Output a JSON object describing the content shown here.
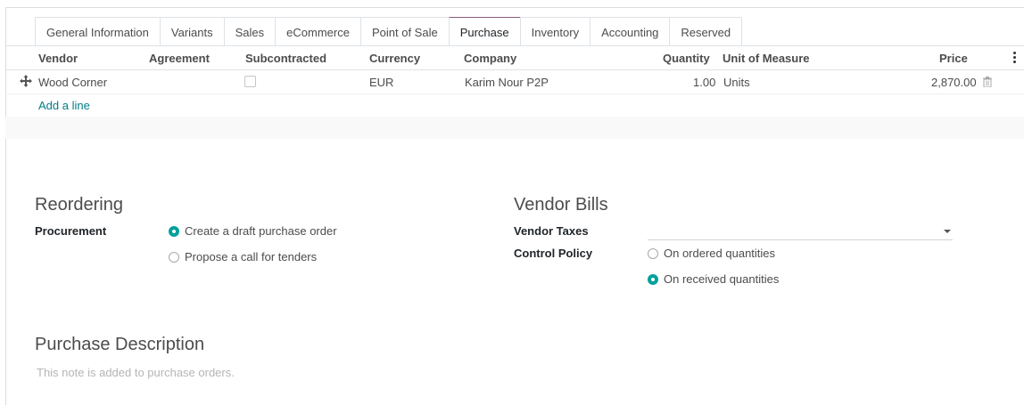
{
  "tabs": [
    {
      "label": "General Information",
      "active": false
    },
    {
      "label": "Variants",
      "active": false
    },
    {
      "label": "Sales",
      "active": false
    },
    {
      "label": "eCommerce",
      "active": false
    },
    {
      "label": "Point of Sale",
      "active": false
    },
    {
      "label": "Purchase",
      "active": true
    },
    {
      "label": "Inventory",
      "active": false
    },
    {
      "label": "Accounting",
      "active": false
    },
    {
      "label": "Reserved",
      "active": false
    }
  ],
  "table": {
    "columns": [
      "Vendor",
      "Agreement",
      "Subcontracted",
      "Currency",
      "Company",
      "Quantity",
      "Unit of Measure",
      "Price"
    ],
    "rows": [
      {
        "vendor": "Wood Corner",
        "agreement": "",
        "subcontracted": false,
        "currency": "EUR",
        "company": "Karim Nour P2P",
        "quantity": "1.00",
        "uom": "Units",
        "price": "2,870.00"
      }
    ],
    "add_line": "Add a line"
  },
  "reordering": {
    "title": "Reordering",
    "procurement_label": "Procurement",
    "options": [
      {
        "label": "Create a draft purchase order",
        "selected": true
      },
      {
        "label": "Propose a call for tenders",
        "selected": false
      }
    ]
  },
  "vendor_bills": {
    "title": "Vendor Bills",
    "vendor_taxes_label": "Vendor Taxes",
    "vendor_taxes_value": "",
    "control_policy_label": "Control Policy",
    "options": [
      {
        "label": "On ordered quantities",
        "selected": false
      },
      {
        "label": "On received quantities",
        "selected": true
      }
    ]
  },
  "purchase_description": {
    "title": "Purchase Description",
    "placeholder": "This note is added to purchase orders."
  },
  "colors": {
    "accent": "#00a09d",
    "link": "#017e84",
    "tab_active": "#875a7b"
  }
}
